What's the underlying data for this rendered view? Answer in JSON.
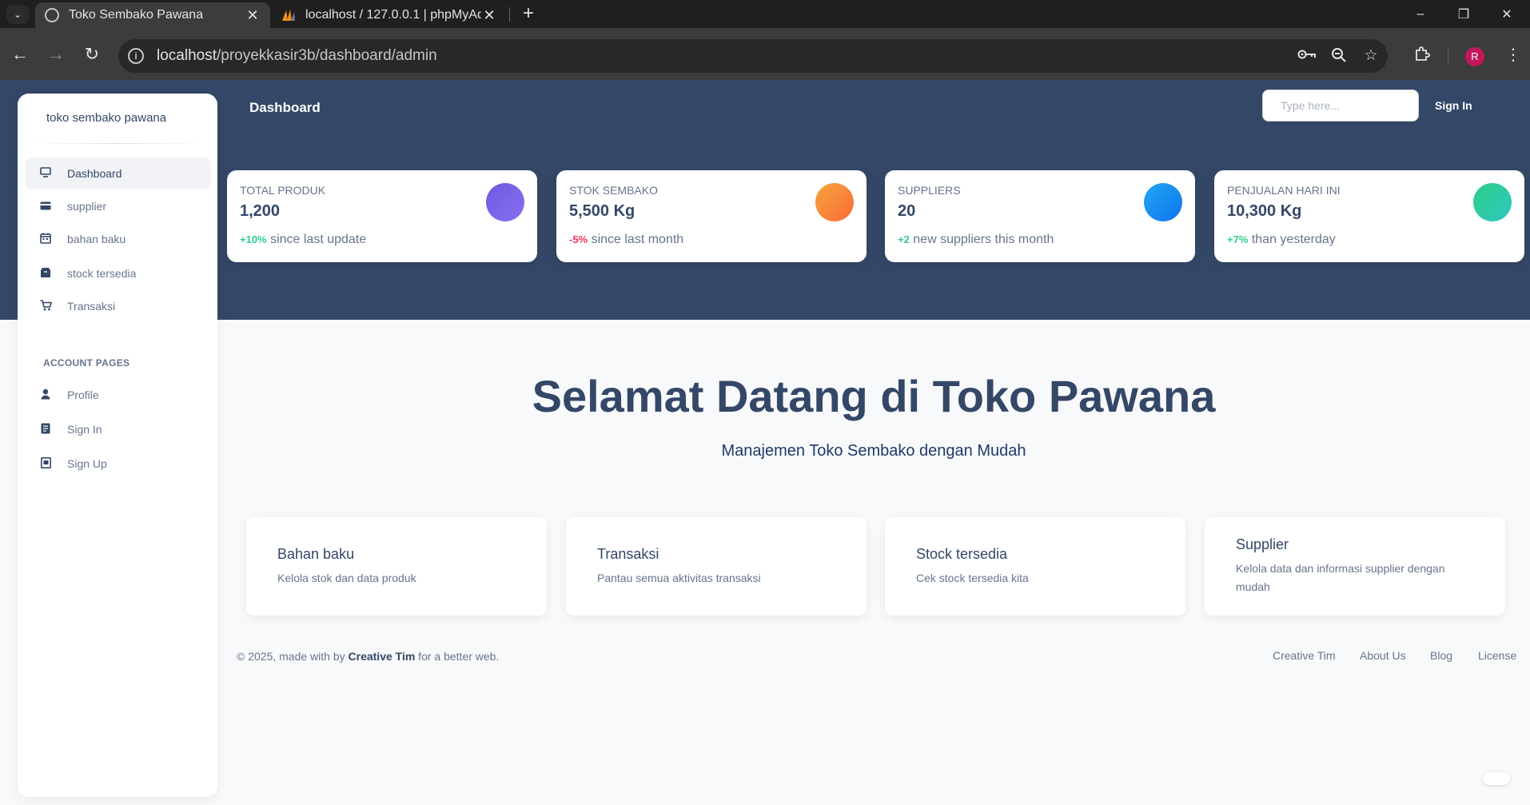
{
  "browser": {
    "tabs": [
      {
        "title": "Toko Sembako Pawana",
        "active": true,
        "favicon": "globe-icon"
      },
      {
        "title": "localhost / 127.0.0.1 | phpMyAd",
        "active": false,
        "favicon": "phpmyadmin-icon"
      }
    ],
    "url_host": "localhost",
    "url_path": "/proyekkasir3b/dashboard/admin",
    "profile_initial": "R"
  },
  "sidebar": {
    "brand": "toko sembako pawana",
    "items": [
      {
        "label": "Dashboard",
        "icon": "monitor-icon",
        "active": true
      },
      {
        "label": "supplier",
        "icon": "credit-card-icon"
      },
      {
        "label": "bahan baku",
        "icon": "calendar-icon"
      },
      {
        "label": "stock tersedia",
        "icon": "box-icon"
      },
      {
        "label": "Transaksi",
        "icon": "cart-icon"
      }
    ],
    "account_heading": "ACCOUNT PAGES",
    "account_items": [
      {
        "label": "Profile",
        "icon": "user-icon"
      },
      {
        "label": "Sign In",
        "icon": "document-icon"
      },
      {
        "label": "Sign Up",
        "icon": "signup-icon"
      }
    ]
  },
  "header": {
    "title": "Dashboard",
    "search_placeholder": "Type here...",
    "signin": "Sign In"
  },
  "stats": [
    {
      "label": "Total Produk",
      "value": "1,200",
      "change": "+10%",
      "change_color": "#2dce89",
      "suffix": " since last update",
      "color_from": "#6a5be0",
      "color_to": "#8b6ef0"
    },
    {
      "label": "Stok Sembako",
      "value": "5,500 Kg",
      "change": "-5%",
      "change_color": "#f5365c",
      "suffix": " since last month",
      "color_from": "#f5a43b",
      "color_to": "#fb6b3a"
    },
    {
      "label": "Suppliers",
      "value": "20",
      "change": "+2",
      "change_color": "#2dce89",
      "suffix": " new suppliers this month",
      "color_from": "#1fa8f0",
      "color_to": "#1172ef"
    },
    {
      "label": "Penjualan Hari Ini",
      "value": "10,300 Kg",
      "change": "+7%",
      "change_color": "#2dce89",
      "suffix": " than yesterday",
      "color_from": "#2dce89",
      "color_to": "#2ec7c0"
    }
  ],
  "welcome": {
    "title": "Selamat Datang di Toko Pawana",
    "subtitle": "Manajemen Toko Sembako dengan Mudah"
  },
  "features": [
    {
      "title": "Bahan baku",
      "desc": "Kelola stok dan data produk"
    },
    {
      "title": "Transaksi",
      "desc": "Pantau semua aktivitas transaksi"
    },
    {
      "title": "Stock tersedia",
      "desc": "Cek stock tersedia kita"
    },
    {
      "title": "Supplier",
      "desc": "Kelola data dan informasi supplier dengan mudah"
    }
  ],
  "footer": {
    "copyright_prefix": "© 2025, made with by ",
    "copyright_brand": "Creative Tim",
    "copyright_suffix": " for a better web.",
    "links": [
      "Creative Tim",
      "About Us",
      "Blog",
      "License"
    ]
  }
}
